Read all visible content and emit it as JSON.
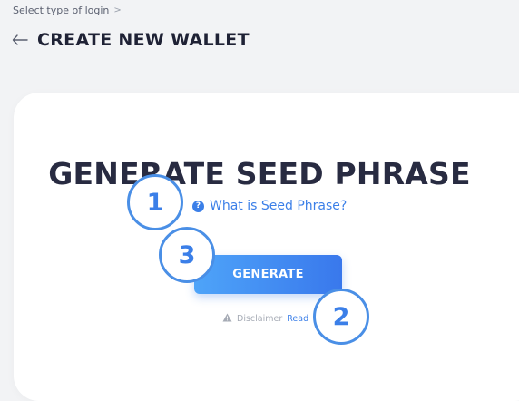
{
  "breadcrumb": {
    "label": "Select type of login",
    "separator": ">"
  },
  "header": {
    "title": "CREATE NEW WALLET",
    "back_icon": "arrow-left-icon"
  },
  "main": {
    "title": "GENERATE SEED PHRASE",
    "help_link": "What is Seed Phrase?",
    "help_icon": "question-circle-icon",
    "generate_button": "GENERATE",
    "disclaimer_icon": "warning-triangle-icon",
    "disclaimer_label": "Disclaimer",
    "read_link": "Read"
  },
  "badges": [
    "1",
    "2",
    "3"
  ],
  "colors": {
    "accent": "#3b7fe8",
    "title": "#282b41",
    "background": "#f2f3f5",
    "card": "#ffffff"
  }
}
